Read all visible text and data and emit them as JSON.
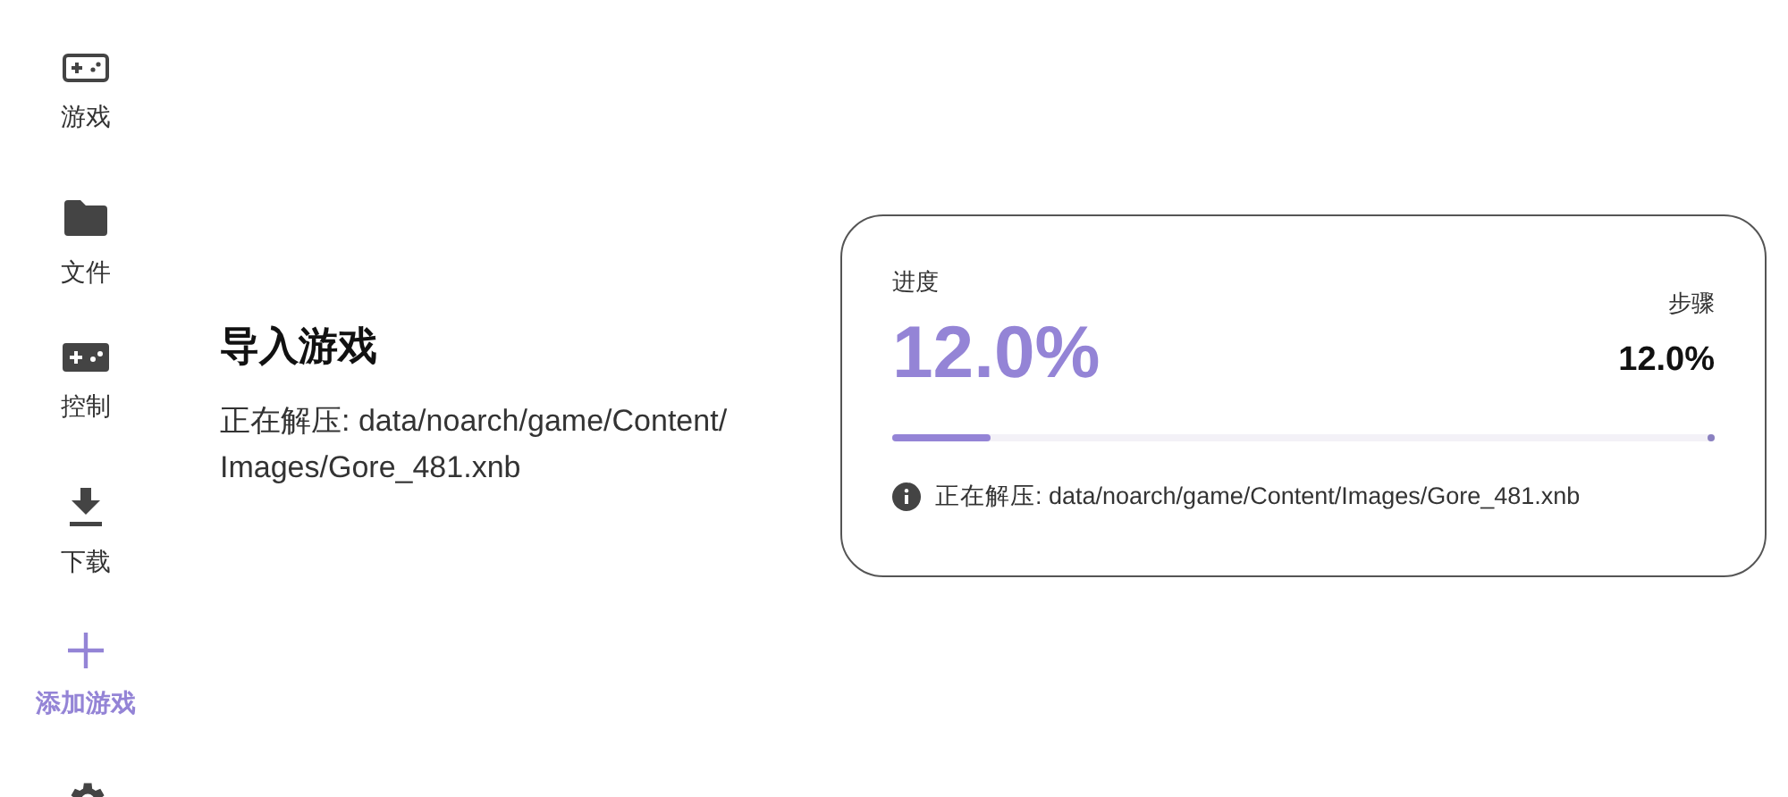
{
  "sidebar": {
    "items": [
      {
        "kind": "gamepad",
        "label": "游戏",
        "selected": false
      },
      {
        "kind": "folder",
        "label": "文件",
        "selected": false
      },
      {
        "kind": "controller",
        "label": "控制",
        "selected": false
      },
      {
        "kind": "download",
        "label": "下载",
        "selected": false
      },
      {
        "kind": "add",
        "label": "添加游戏",
        "selected": true
      },
      {
        "kind": "settings",
        "selected": false
      }
    ]
  },
  "import": {
    "title": "导入游戏",
    "status": "正在解压: data/noarch/game/Content/Images/Gore_481.xnb"
  },
  "progress_card": {
    "progress_label": "进度",
    "progress_value": "12.0%",
    "step_label": "步骤",
    "step_value": "12.0%",
    "level": 0.12,
    "message": "正在解压: data/noarch/game/Content/Images/Gore_481.xnb"
  }
}
